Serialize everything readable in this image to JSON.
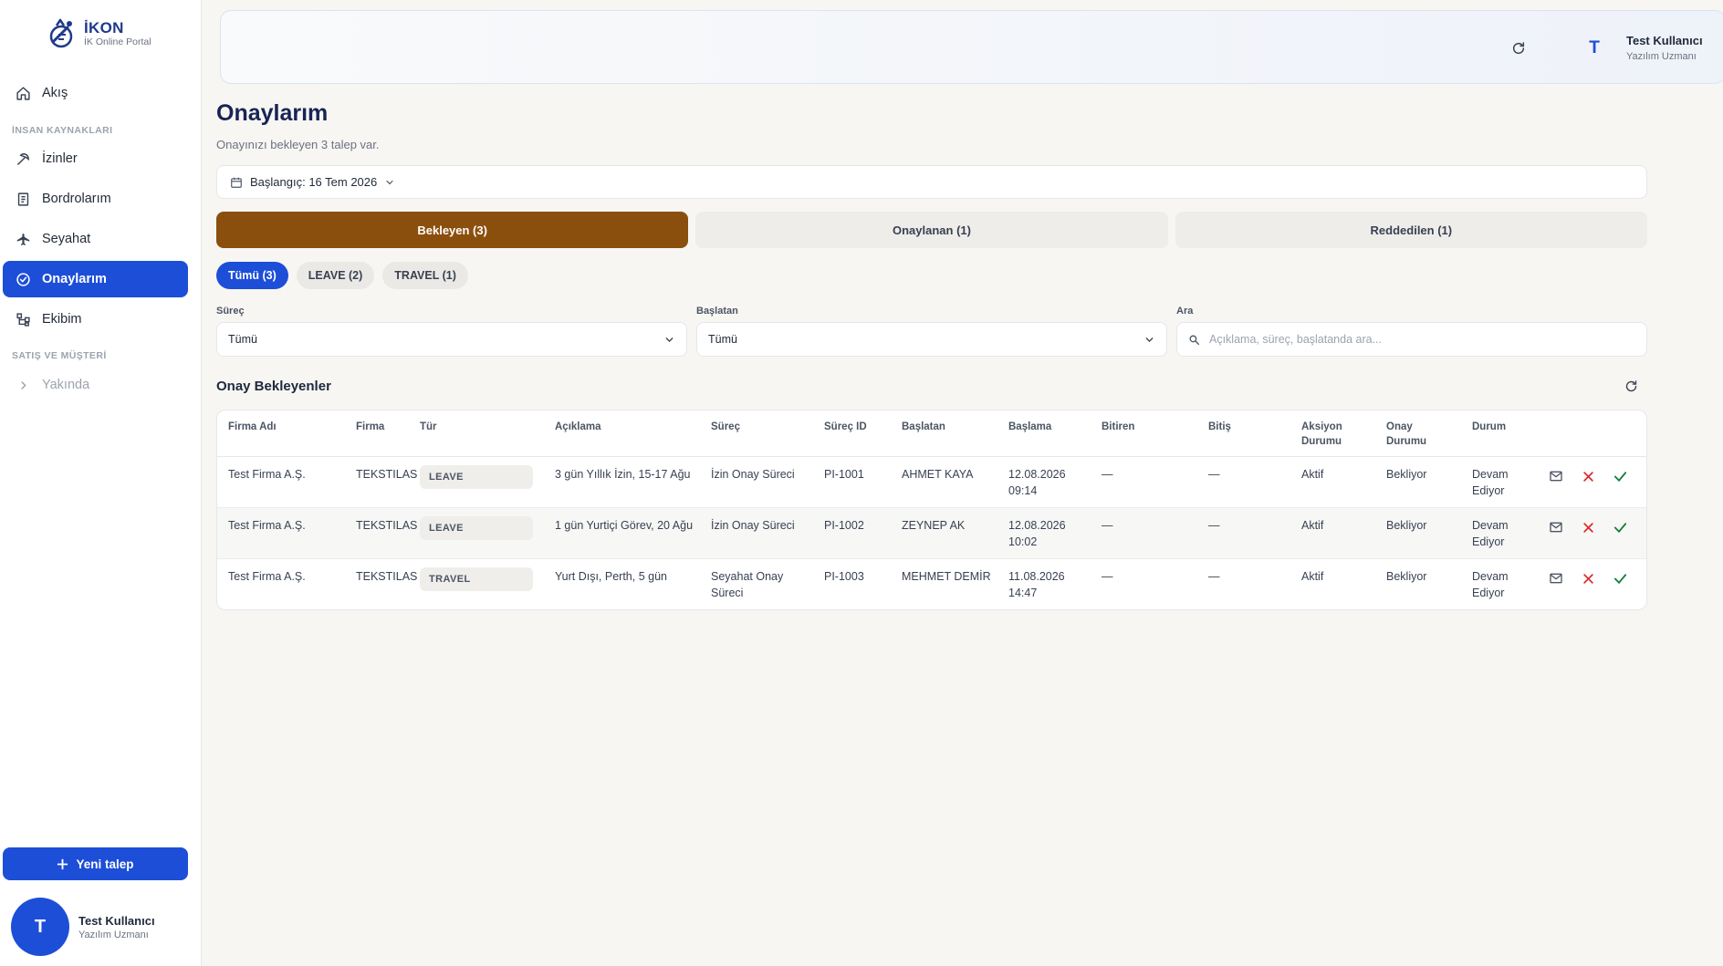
{
  "app": {
    "logo_title": "İKON",
    "logo_subtitle": "İK Online Portal"
  },
  "sidebar": {
    "items": [
      {
        "label": "Akış",
        "icon": "home-icon"
      },
      {
        "label": "İzinler",
        "icon": "leave-icon"
      },
      {
        "label": "Bordrolarım",
        "icon": "payroll-icon"
      },
      {
        "label": "Seyahat",
        "icon": "plane-icon"
      },
      {
        "label": "Onaylarım",
        "icon": "check-circle-icon",
        "active": true
      },
      {
        "label": "Ekibim",
        "icon": "team-icon"
      },
      {
        "label": "Yakında",
        "icon": "chevron-right-icon"
      }
    ],
    "sections": {
      "hr": "İNSAN KAYNAKLARI",
      "sales": "SATIŞ VE MÜŞTERİ"
    },
    "new_request_label": "Yeni talep",
    "user": {
      "initial": "T",
      "name": "Test Kullanıcı",
      "role": "Yazılım Uzmanı"
    }
  },
  "header": {
    "user": {
      "initial": "T",
      "name": "Test Kullanıcı",
      "role": "Yazılım Uzmanı"
    }
  },
  "main": {
    "title": "Onaylarım",
    "subtitle": "Onayınızı bekleyen 3 talep var.",
    "date_filter": "Başlangıç: 16 Tem 2026",
    "tabs": [
      {
        "label": "Bekleyen (3)",
        "active": true
      },
      {
        "label": "Onaylanan (1)",
        "active": false
      },
      {
        "label": "Reddedilen (1)",
        "active": false
      }
    ],
    "chips": [
      {
        "label": "Tümü (3)",
        "active": true
      },
      {
        "label": "LEAVE (2)",
        "active": false
      },
      {
        "label": "TRAVEL (1)",
        "active": false
      }
    ],
    "filters": {
      "process_label": "Süreç",
      "process_value": "Tümü",
      "initiator_label": "Başlatan",
      "initiator_value": "Tümü",
      "search_label": "Ara",
      "search_placeholder": "Açıklama, süreç, başlatanda ara..."
    },
    "section_title": "Onay Bekleyenler",
    "table": {
      "headers": [
        "Firma Adı",
        "Firma",
        "Tür",
        "Açıklama",
        "Süreç",
        "Süreç ID",
        "Başlatan",
        "Başlama",
        "Bitiren",
        "Bitiş",
        "Aksiyon Durumu",
        "Onay Durumu",
        "Durum"
      ],
      "rows": [
        [
          "Test Firma A.Ş.",
          "TEKSTILAS",
          "LEAVE",
          "3 gün Yıllık İzin, 15-17 Ağu",
          "İzin Onay Süreci",
          "PI-1001",
          "AHMET KAYA",
          "12.08.2026 09:14",
          "—",
          "—",
          "Aktif",
          "Bekliyor",
          "Devam Ediyor"
        ],
        [
          "Test Firma A.Ş.",
          "TEKSTILAS",
          "LEAVE",
          "1 gün Yurtiçi Görev, 20 Ağu",
          "İzin Onay Süreci",
          "PI-1002",
          "ZEYNEP AK",
          "12.08.2026 10:02",
          "—",
          "—",
          "Aktif",
          "Bekliyor",
          "Devam Ediyor"
        ],
        [
          "Test Firma A.Ş.",
          "TEKSTILAS",
          "TRAVEL",
          "Yurt Dışı, Perth, 5 gün",
          "Seyahat Onay Süreci",
          "PI-1003",
          "MEHMET DEMİR",
          "11.08.2026 14:47",
          "—",
          "—",
          "Aktif",
          "Bekliyor",
          "Devam Ediyor"
        ]
      ]
    }
  },
  "colors": {
    "primary": "#1d4ed8",
    "tab_active": "#8b4f0d",
    "reject": "#dc2626",
    "approve": "#15803d"
  }
}
